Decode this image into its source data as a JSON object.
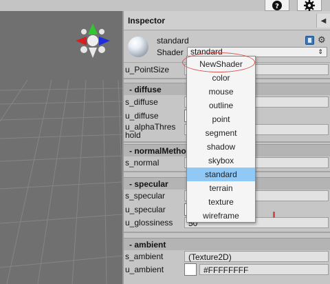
{
  "window": {
    "help_icon": "question-circle-icon",
    "settings_icon": "gear-icon"
  },
  "viewport": {
    "gizmo_icon": "scene-orientation-gizmo-icon"
  },
  "inspector": {
    "title": "Inspector",
    "collapse_icon": "triangle-left-icon",
    "material_name": "standard",
    "shader_label": "Shader",
    "shader_value": "standard",
    "rows": {
      "u_pointsize": "u_PointSize",
      "s_diffuse": "s_diffuse",
      "u_diffuse": "u_diffuse",
      "u_alphathreshold_1": "u_alphaThres",
      "u_alphathreshold_2": "hold",
      "s_normal": "s_normal",
      "s_specular": "s_specular",
      "u_specular": "u_specular",
      "u_glossiness": "u_glossiness",
      "u_glossiness_value": "50",
      "s_ambient": "s_ambient",
      "s_ambient_value": "(Texture2D)",
      "u_ambient": "u_ambient",
      "u_ambient_value": "#FFFFFFFF"
    },
    "sections": {
      "diffuse": "diffuse",
      "normal": "normalMetho",
      "specular": "specular",
      "ambient": "ambient"
    }
  },
  "dropdown": {
    "items": [
      "NewShader",
      "color",
      "mouse",
      "outline",
      "point",
      "segment",
      "shadow",
      "skybox",
      "standard",
      "terrain",
      "texture",
      "wireframe"
    ],
    "selected": "standard"
  },
  "colors": {
    "selection": "#90c8f6",
    "annotation_ring": "#d9534f"
  }
}
